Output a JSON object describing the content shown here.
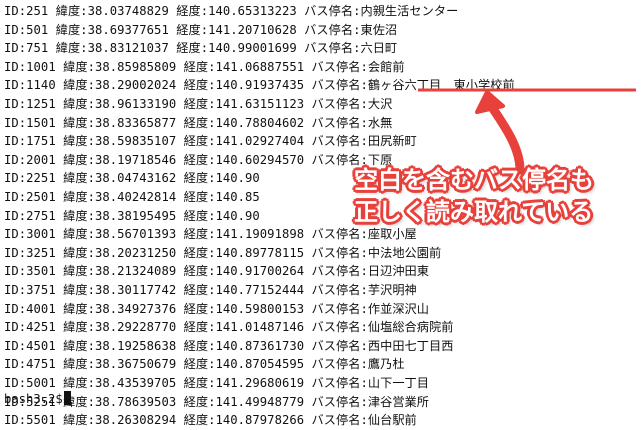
{
  "terminal": {
    "lines": [
      "ID:251 緯度:38.03748829 経度:140.65313223 バス停名:内親生活センター",
      "ID:501 緯度:38.69377651 経度:141.20710628 バス停名:東佐沼",
      "ID:751 緯度:38.83121037 経度:140.99001699 バス停名:六日町",
      "ID:1001 緯度:38.85985809 経度:141.06887551 バス停名:会館前",
      "ID:1140 緯度:38.29002024 経度:140.91937435 バス停名:鶴ヶ谷六丁目　東小学校前",
      "ID:1251 緯度:38.96133190 経度:141.63151123 バス停名:大沢",
      "ID:1501 緯度:38.83365877 経度:140.78804602 バス停名:水無",
      "ID:1751 緯度:38.59835107 経度:141.02927404 バス停名:田尻新町",
      "ID:2001 緯度:38.19718546 経度:140.60294570 バス停名:下原",
      "ID:2251 緯度:38.04743162 経度:140.90",
      "ID:2501 緯度:38.40242814 経度:140.85",
      "ID:2751 緯度:38.38195495 経度:140.90",
      "ID:3001 緯度:38.56701393 経度:141.19091898 バス停名:座取小屋",
      "ID:3251 緯度:38.20231250 経度:140.89778115 バス停名:中法地公園前",
      "ID:3501 緯度:38.21324089 経度:140.91700264 バス停名:日辺沖田東",
      "ID:3751 緯度:38.30117742 経度:140.77152444 バス停名:芋沢明神",
      "ID:4001 緯度:38.34927376 経度:140.59800153 バス停名:作並深沢山",
      "ID:4251 緯度:38.29228770 経度:141.01487146 バス停名:仙塩総合病院前",
      "ID:4501 緯度:38.19258638 経度:140.87361730 バス停名:西中田七丁目西",
      "ID:4751 緯度:38.36750679 経度:140.87054595 バス停名:鷹乃杜",
      "ID:5001 緯度:38.43539705 経度:141.29680619 バス停名:山下一丁目",
      "ID:5251 緯度:38.78639503 経度:141.49948779 バス停名:津谷営業所",
      "ID:5501 緯度:38.26308294 経度:140.87978266 バス停名:仙台駅前"
    ],
    "prompt": "bash3.2$"
  },
  "annotation": {
    "text": "空白を含むバス停名も\n正しく読み取れている",
    "color": "#e8403a"
  }
}
